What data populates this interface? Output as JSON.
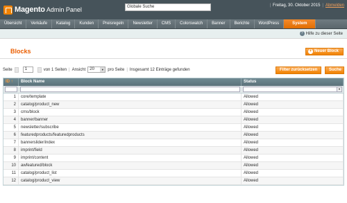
{
  "header": {
    "logo_brand": "Magento",
    "logo_sub": "Admin Panel",
    "search_value": "Globale Suche",
    "date": "Freitag, 30. Oktober 2015",
    "logout": "Abmelden",
    "separator": "|"
  },
  "nav": {
    "items": [
      "Übersicht",
      "Verkäufe",
      "Katalog",
      "Kunden",
      "Preisregeln",
      "Newsletter",
      "CMS",
      "Colorswatch",
      "Banner",
      "Berichte",
      "WordPress",
      "System"
    ]
  },
  "subbar": {
    "help": "Hilfe zu dieser Seite"
  },
  "page": {
    "title": "Blocks",
    "new_button": "Neuer Block"
  },
  "pager": {
    "page_label": "Seite",
    "page_value": "1",
    "of_pages": "von 1 Seiten",
    "view_label": "Ansicht",
    "per_page": "20",
    "per_page_suffix": "pro Seite",
    "total": "Insgesamt 12 Einträge gefunden",
    "bar": "|",
    "reset_button": "Filter zurücksetzen",
    "search_button": "Suche"
  },
  "grid": {
    "columns": {
      "id": "ID",
      "name": "Block Name",
      "status": "Status"
    },
    "sort_arrow": "↑",
    "rows": [
      {
        "id": "1",
        "name": "core/template",
        "status": "Allowed"
      },
      {
        "id": "2",
        "name": "catalog/product_new",
        "status": "Allowed"
      },
      {
        "id": "3",
        "name": "cms/block",
        "status": "Allowed"
      },
      {
        "id": "4",
        "name": "banner/banner",
        "status": "Allowed"
      },
      {
        "id": "5",
        "name": "newsletter/subscribe",
        "status": "Allowed"
      },
      {
        "id": "6",
        "name": "featuredproducts/featuredproducts",
        "status": "Allowed"
      },
      {
        "id": "7",
        "name": "bannerslider/index",
        "status": "Allowed"
      },
      {
        "id": "8",
        "name": "imprint/field",
        "status": "Allowed"
      },
      {
        "id": "9",
        "name": "imprint/content",
        "status": "Allowed"
      },
      {
        "id": "10",
        "name": "awfeatured/block",
        "status": "Allowed"
      },
      {
        "id": "11",
        "name": "catalog/product_list",
        "status": "Allowed"
      },
      {
        "id": "12",
        "name": "catalog/product_view",
        "status": "Allowed"
      }
    ]
  },
  "colors": {
    "accent": "#eb5e00",
    "header_bg": "#46535a",
    "nav_active": "#f18200"
  }
}
